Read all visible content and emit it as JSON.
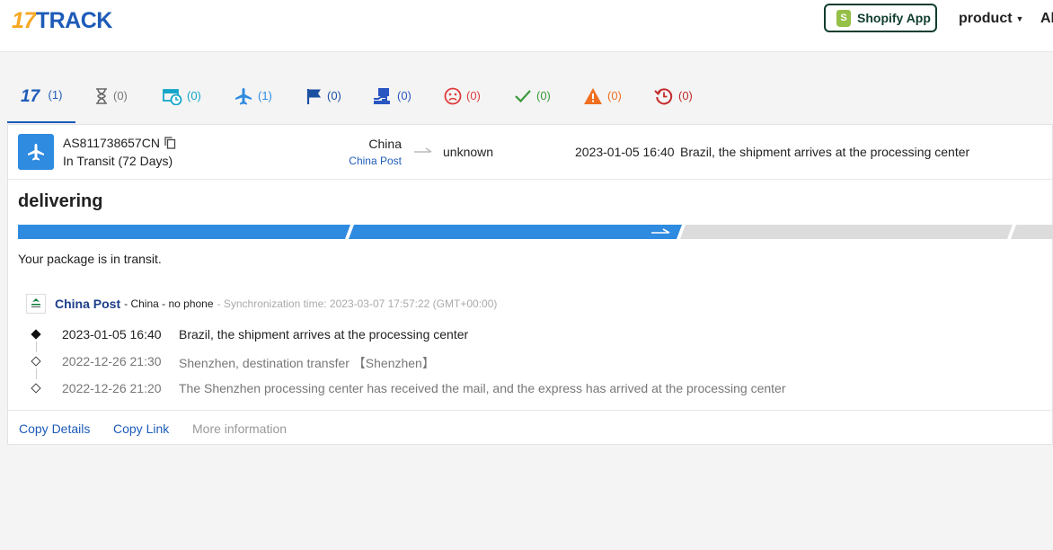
{
  "header": {
    "logo_num": "17",
    "logo_word": "TRACK",
    "shopify_label": "Shopify App",
    "nav_product": "product",
    "nav_more": "Al"
  },
  "tabs": [
    {
      "icon": "17track-all-icon",
      "count": "(1)",
      "color": "#1d5bb8"
    },
    {
      "icon": "hourglass-icon",
      "count": "(0)",
      "color": "#777777"
    },
    {
      "icon": "truck-clock-icon",
      "count": "(0)",
      "color": "#14a6c9"
    },
    {
      "icon": "airplane-icon",
      "count": "(1)",
      "color": "#2f8be0"
    },
    {
      "icon": "flag-icon",
      "count": "(0)",
      "color": "#1d4fa0"
    },
    {
      "icon": "pickup-box-icon",
      "count": "(0)",
      "color": "#2a56c2"
    },
    {
      "icon": "sad-face-icon",
      "count": "(0)",
      "color": "#e03b3b"
    },
    {
      "icon": "checkmark-icon",
      "count": "(0)",
      "color": "#3a9a3a"
    },
    {
      "icon": "warning-icon",
      "count": "(0)",
      "color": "#f07020"
    },
    {
      "icon": "history-clock-icon",
      "count": "(0)",
      "color": "#c42a2a"
    }
  ],
  "shipment": {
    "tracking_number": "AS811738657CN",
    "status": "In Transit (72 Days)",
    "origin": "China",
    "carrier": "China Post",
    "destination": "unknown",
    "latest_time": "2023-01-05 16:40",
    "latest_desc": "Brazil, the shipment arrives at the processing center"
  },
  "progress": {
    "stage_label": "delivering",
    "completed_segments": 2,
    "total_segments": 4,
    "note": "Your package is in transit."
  },
  "carrier_info": {
    "name": "China Post",
    "meta": "- China - no phone",
    "sync": "- Synchronization time: 2023-03-07 17:57:22 (GMT+00:00)"
  },
  "events": [
    {
      "time": "2023-01-05 16:40",
      "desc": "Brazil, the shipment arrives at the processing center"
    },
    {
      "time": "2022-12-26 21:30",
      "desc": "Shenzhen, destination transfer 【Shenzhen】"
    },
    {
      "time": "2022-12-26 21:20",
      "desc": "The Shenzhen processing center has received the mail, and the express has arrived at the processing center"
    }
  ],
  "actions": {
    "copy_details": "Copy Details",
    "copy_link": "Copy Link",
    "more_info": "More information"
  }
}
